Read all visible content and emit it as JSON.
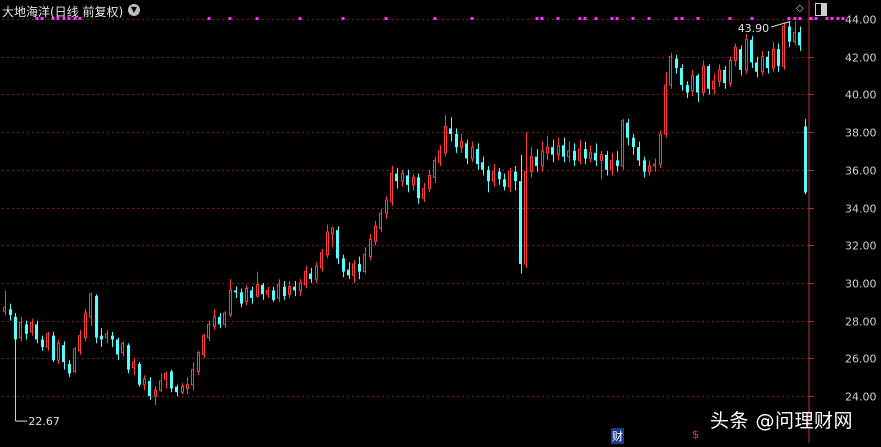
{
  "header": {
    "title": "大地海洋(日线 前复权)",
    "dropdown_icon": "chevron-down-icon",
    "corner_icons": [
      "diamond-icon",
      "panel-toggle-icon"
    ]
  },
  "badges": {
    "cai": "财",
    "s": "$"
  },
  "watermark": "头条 @问理财网",
  "colors": {
    "up": "#ff3c3c",
    "down": "#54ffff",
    "signal": "#ff33ff",
    "grid": "#7a1f1f",
    "axis": "#c03030",
    "axis_text": "#cfcfcf"
  },
  "chart_data": {
    "type": "candlestick",
    "y_axis": {
      "ticks": [
        "24.00",
        "26.00",
        "28.00",
        "30.00",
        "32.00",
        "34.00",
        "36.00",
        "38.00",
        "40.00",
        "42.00",
        "44.00"
      ],
      "ylim": [
        23,
        44.5
      ],
      "position": "right",
      "grid": true
    },
    "annotations": {
      "high_label": "43.90",
      "low_label": "22.67"
    },
    "candles": [
      [
        28.5,
        28.7,
        28.3,
        29.6
      ],
      [
        28.6,
        28.3,
        28.0,
        28.9
      ],
      [
        28.2,
        27.0,
        22.67,
        28.4
      ],
      [
        27.1,
        27.9,
        26.9,
        28.2
      ],
      [
        27.8,
        27.3,
        27.0,
        28.0
      ],
      [
        27.4,
        27.9,
        27.2,
        28.1
      ],
      [
        27.8,
        27.0,
        26.8,
        28.0
      ],
      [
        27.0,
        26.6,
        26.4,
        27.2
      ],
      [
        26.6,
        27.3,
        26.4,
        27.4
      ],
      [
        27.2,
        25.9,
        25.8,
        27.4
      ],
      [
        25.9,
        26.8,
        25.7,
        27.0
      ],
      [
        26.7,
        25.8,
        25.4,
        26.9
      ],
      [
        25.7,
        25.2,
        25.0,
        25.9
      ],
      [
        25.3,
        26.5,
        25.2,
        26.6
      ],
      [
        26.4,
        27.2,
        26.2,
        27.5
      ],
      [
        27.1,
        28.4,
        26.9,
        28.6
      ],
      [
        28.2,
        29.4,
        27.7,
        29.5
      ],
      [
        29.3,
        27.1,
        26.8,
        29.4
      ],
      [
        27.2,
        27.0,
        26.6,
        27.6
      ],
      [
        27.1,
        27.3,
        26.8,
        27.5
      ],
      [
        27.2,
        27.0,
        26.6,
        27.4
      ],
      [
        27.0,
        26.2,
        25.9,
        27.1
      ],
      [
        26.3,
        26.8,
        26.1,
        26.9
      ],
      [
        26.7,
        25.4,
        25.2,
        26.8
      ],
      [
        25.5,
        25.8,
        25.1,
        26.0
      ],
      [
        25.7,
        24.6,
        24.5,
        25.8
      ],
      [
        24.6,
        24.9,
        24.3,
        25.1
      ],
      [
        24.8,
        24.0,
        23.8,
        25.0
      ],
      [
        24.0,
        24.3,
        23.5,
        24.5
      ],
      [
        24.3,
        24.8,
        24.2,
        25.2
      ],
      [
        24.9,
        25.2,
        24.4,
        25.3
      ],
      [
        25.3,
        24.4,
        24.2,
        25.4
      ],
      [
        24.5,
        24.2,
        24.0,
        24.6
      ],
      [
        24.2,
        24.5,
        24.1,
        24.7
      ],
      [
        24.4,
        24.6,
        24.1,
        25.0
      ],
      [
        24.6,
        25.4,
        24.3,
        25.8
      ],
      [
        25.3,
        26.3,
        25.1,
        26.4
      ],
      [
        26.2,
        27.2,
        26.0,
        27.3
      ],
      [
        27.1,
        27.8,
        26.9,
        28.0
      ],
      [
        27.7,
        28.2,
        27.5,
        28.6
      ],
      [
        28.2,
        27.8,
        27.6,
        28.4
      ],
      [
        27.8,
        28.4,
        27.6,
        28.5
      ],
      [
        28.3,
        29.6,
        28.2,
        30.2
      ],
      [
        29.6,
        29.5,
        29.2,
        29.8
      ],
      [
        29.5,
        28.9,
        28.7,
        29.7
      ],
      [
        29.0,
        29.7,
        28.8,
        29.9
      ],
      [
        29.6,
        29.2,
        28.9,
        29.8
      ],
      [
        29.3,
        29.9,
        29.2,
        30.6
      ],
      [
        29.9,
        29.4,
        29.1,
        30.0
      ],
      [
        29.4,
        29.6,
        29.2,
        29.8
      ],
      [
        29.6,
        29.1,
        29.0,
        29.8
      ],
      [
        29.2,
        29.9,
        29.0,
        30.2
      ],
      [
        29.8,
        29.3,
        29.1,
        30.1
      ],
      [
        29.4,
        29.8,
        29.2,
        30.1
      ],
      [
        29.8,
        29.6,
        29.3,
        30.1
      ],
      [
        29.6,
        30.0,
        29.3,
        30.2
      ],
      [
        29.9,
        30.6,
        29.7,
        30.9
      ],
      [
        30.5,
        30.2,
        30.0,
        30.8
      ],
      [
        30.2,
        30.9,
        30.0,
        31.1
      ],
      [
        30.8,
        31.6,
        30.6,
        31.8
      ],
      [
        31.5,
        32.7,
        31.3,
        33.1
      ],
      [
        32.6,
        32.9,
        31.9,
        33.0
      ],
      [
        32.8,
        31.3,
        31.0,
        33.0
      ],
      [
        31.3,
        30.6,
        30.3,
        31.5
      ],
      [
        30.7,
        30.4,
        30.2,
        31.1
      ],
      [
        30.4,
        31.0,
        30.0,
        31.2
      ],
      [
        31.0,
        30.6,
        30.2,
        31.4
      ],
      [
        30.6,
        31.5,
        30.5,
        31.9
      ],
      [
        31.4,
        32.3,
        31.2,
        32.6
      ],
      [
        32.2,
        33.0,
        32.0,
        33.3
      ],
      [
        32.9,
        33.7,
        32.7,
        33.9
      ],
      [
        33.7,
        34.4,
        33.4,
        34.6
      ],
      [
        34.3,
        35.8,
        34.1,
        36.2
      ],
      [
        35.8,
        35.4,
        35.0,
        36.1
      ],
      [
        35.4,
        35.8,
        35.1,
        36.0
      ],
      [
        35.7,
        35.2,
        34.8,
        36.0
      ],
      [
        35.2,
        35.6,
        34.9,
        35.8
      ],
      [
        35.6,
        34.5,
        34.2,
        35.8
      ],
      [
        34.5,
        35.0,
        34.3,
        35.3
      ],
      [
        35.0,
        35.7,
        34.8,
        36.0
      ],
      [
        35.6,
        36.5,
        35.3,
        36.7
      ],
      [
        36.4,
        37.0,
        36.2,
        37.3
      ],
      [
        36.9,
        38.3,
        36.7,
        38.9
      ],
      [
        38.2,
        37.9,
        37.5,
        38.8
      ],
      [
        37.9,
        37.2,
        36.9,
        38.2
      ],
      [
        37.2,
        37.5,
        36.9,
        37.9
      ],
      [
        37.4,
        36.6,
        36.3,
        37.6
      ],
      [
        36.6,
        37.2,
        36.4,
        37.5
      ],
      [
        37.1,
        36.3,
        36.0,
        37.4
      ],
      [
        36.4,
        36.0,
        35.7,
        36.7
      ],
      [
        36.0,
        35.4,
        34.8,
        36.2
      ],
      [
        35.4,
        35.9,
        35.1,
        36.3
      ],
      [
        35.9,
        35.5,
        35.2,
        36.1
      ],
      [
        35.5,
        35.1,
        34.9,
        35.8
      ],
      [
        35.1,
        35.9,
        34.8,
        36.1
      ],
      [
        35.9,
        35.4,
        34.9,
        36.2
      ],
      [
        35.4,
        31.0,
        30.5,
        36.8
      ],
      [
        31.0,
        35.9,
        30.8,
        38.0
      ],
      [
        35.9,
        36.7,
        35.6,
        37.2
      ],
      [
        36.7,
        36.2,
        35.9,
        37.1
      ],
      [
        36.2,
        37.0,
        35.9,
        37.5
      ],
      [
        36.9,
        37.2,
        36.5,
        37.8
      ],
      [
        37.2,
        36.8,
        36.4,
        37.6
      ],
      [
        36.8,
        37.3,
        36.5,
        37.7
      ],
      [
        37.3,
        36.7,
        36.4,
        37.7
      ],
      [
        36.7,
        37.0,
        36.4,
        37.5
      ],
      [
        37.0,
        36.5,
        36.2,
        37.4
      ],
      [
        36.5,
        37.1,
        36.3,
        37.6
      ],
      [
        37.1,
        36.6,
        36.3,
        37.5
      ],
      [
        36.6,
        36.9,
        36.4,
        37.3
      ],
      [
        36.9,
        36.5,
        36.2,
        37.4
      ],
      [
        36.5,
        36.8,
        35.5,
        37.0
      ],
      [
        36.8,
        36.0,
        35.7,
        37.0
      ],
      [
        36.0,
        36.5,
        35.7,
        36.9
      ],
      [
        36.5,
        36.2,
        35.9,
        37.0
      ],
      [
        36.2,
        38.6,
        36.0,
        38.7
      ],
      [
        38.5,
        37.7,
        37.3,
        38.7
      ],
      [
        37.7,
        37.2,
        36.8,
        37.9
      ],
      [
        37.2,
        36.5,
        36.2,
        37.5
      ],
      [
        36.5,
        35.9,
        35.6,
        36.7
      ],
      [
        35.9,
        36.2,
        35.7,
        36.5
      ],
      [
        36.2,
        36.3,
        35.9,
        36.6
      ],
      [
        36.3,
        37.9,
        36.1,
        38.1
      ],
      [
        37.9,
        40.5,
        37.7,
        41.2
      ],
      [
        40.5,
        42.0,
        40.3,
        42.2
      ],
      [
        41.9,
        41.4,
        41.1,
        42.1
      ],
      [
        41.4,
        40.5,
        40.2,
        41.6
      ],
      [
        40.5,
        40.1,
        39.8,
        40.7
      ],
      [
        40.2,
        41.0,
        39.9,
        41.3
      ],
      [
        41.0,
        40.1,
        39.6,
        41.1
      ],
      [
        40.1,
        41.5,
        39.9,
        41.8
      ],
      [
        41.5,
        40.3,
        40.0,
        41.6
      ],
      [
        40.3,
        40.7,
        40.0,
        41.1
      ],
      [
        40.7,
        41.3,
        40.4,
        41.6
      ],
      [
        41.3,
        40.6,
        40.3,
        41.5
      ],
      [
        40.6,
        41.8,
        40.4,
        42.0
      ],
      [
        41.8,
        42.5,
        41.5,
        42.7
      ],
      [
        42.4,
        41.3,
        41.0,
        42.6
      ],
      [
        41.3,
        42.9,
        41.1,
        43.2
      ],
      [
        42.9,
        41.7,
        41.4,
        43.1
      ],
      [
        41.7,
        41.2,
        40.9,
        42.0
      ],
      [
        41.2,
        42.0,
        41.0,
        42.3
      ],
      [
        42.0,
        41.4,
        41.1,
        42.3
      ],
      [
        41.4,
        42.4,
        41.2,
        42.8
      ],
      [
        42.4,
        41.5,
        41.2,
        42.7
      ],
      [
        41.5,
        43.6,
        41.3,
        43.8
      ],
      [
        43.6,
        42.8,
        42.5,
        43.9
      ],
      [
        42.8,
        43.3,
        42.6,
        43.9
      ],
      [
        43.3,
        42.6,
        42.3,
        43.6
      ],
      [
        38.3,
        34.8,
        34.7,
        38.7
      ]
    ],
    "signal_markers": [
      6,
      7,
      9,
      10,
      11,
      12,
      13,
      14,
      38,
      42,
      47,
      55,
      63,
      71,
      80,
      87,
      99,
      100,
      103,
      107,
      108,
      110,
      113,
      114,
      117,
      120,
      125,
      126,
      129,
      135,
      139,
      146,
      147,
      148,
      150,
      151,
      153,
      154,
      155,
      156
    ]
  }
}
